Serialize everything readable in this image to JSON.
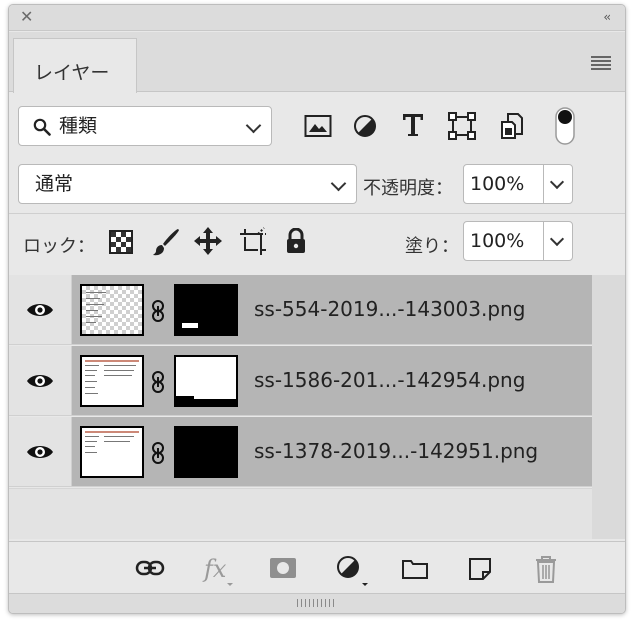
{
  "panel": {
    "tab_label": "レイヤー"
  },
  "filter": {
    "kind_label": "種類",
    "blend_mode": "通常",
    "opacity_label": "不透明度：",
    "opacity_value": "100%",
    "lock_label": "ロック：",
    "fill_label": "塗り：",
    "fill_value": "100%"
  },
  "layers": [
    {
      "name": "ss-554-2019...-143003.png",
      "visible": true
    },
    {
      "name": "ss-1586-201...-142954.png",
      "visible": true
    },
    {
      "name": "ss-1378-2019...-142951.png",
      "visible": true
    }
  ],
  "icons": {
    "filter_icons": [
      "image-filter-icon",
      "adjustment-filter-icon",
      "type-filter-icon",
      "shape-filter-icon",
      "smart-object-filter-icon",
      "filter-toggle-icon"
    ],
    "lock_icons": [
      "lock-transparent-pixels-icon",
      "lock-image-pixels-icon",
      "lock-position-icon",
      "lock-artboard-icon",
      "lock-all-icon"
    ],
    "bottom_icons": [
      "link-layers-icon",
      "fx-icon",
      "add-mask-icon",
      "new-adjustment-layer-icon",
      "new-group-icon",
      "new-layer-icon",
      "delete-layer-icon"
    ]
  }
}
